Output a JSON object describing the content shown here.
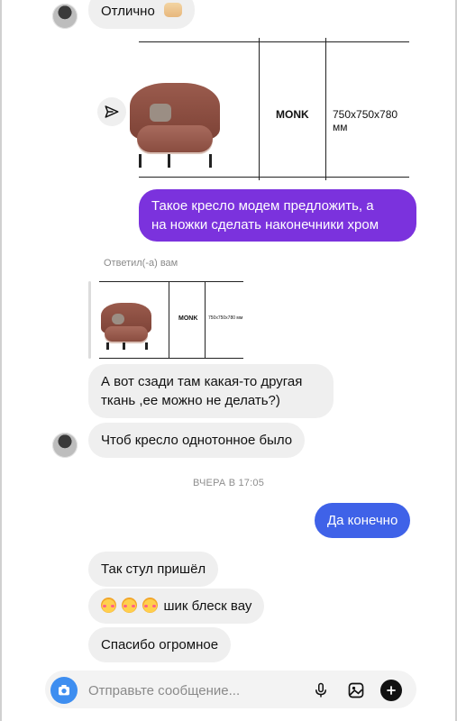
{
  "messages": {
    "top": {
      "text": "Отлично"
    },
    "shared_product": {
      "name": "MONK",
      "size": "750x750x780 мм"
    },
    "out_1": {
      "text_line_1": "Такое кресло модем предложить, а",
      "text_line_2": "на ножки сделать наконечники хром"
    },
    "reply_label": "Ответил(-а) вам",
    "reply_product": {
      "name": "MONK",
      "size": "750x750x780 мм"
    },
    "in_1": {
      "line_1": "А вот сзади там какая-то другая",
      "line_2": "ткань ,ее можно не делать?)"
    },
    "in_2": {
      "text": "Чтоб кресло однотонное было"
    },
    "timestamp": "ВЧЕРА В 17:05",
    "out_2": {
      "text": "Да конечно"
    },
    "in_3": {
      "text": "Так стул пришёл"
    },
    "in_4": {
      "text": "шик блеск вау"
    },
    "in_5": {
      "text": "Спасибо огромное"
    }
  },
  "composer": {
    "placeholder": "Отправьте сообщение..."
  },
  "icons": {
    "share": "send-icon",
    "camera": "camera-icon",
    "mic": "microphone-icon",
    "gallery": "image-icon",
    "plus": "plus-icon",
    "thumbs": "thumbs-up-emoji-icon",
    "emoji": "smiling-face-with-hearts-emoji-icon"
  },
  "colors": {
    "bubble_in": "#efefef",
    "bubble_out_violet": "#7b32dd",
    "bubble_out_blue": "#3f62e8",
    "camera_button": "#3e8ef0"
  }
}
